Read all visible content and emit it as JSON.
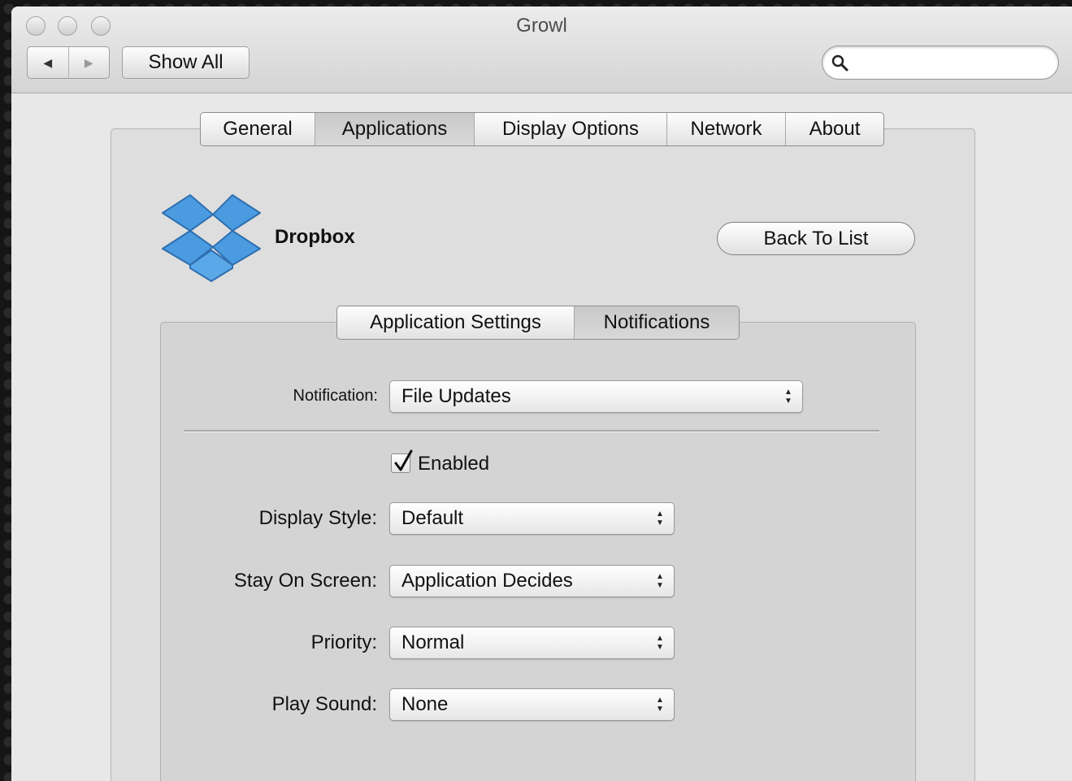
{
  "window": {
    "title": "Growl"
  },
  "toolbar": {
    "show_all_label": "Show All",
    "search_placeholder": ""
  },
  "main_tabs": [
    "General",
    "Applications",
    "Display Options",
    "Network",
    "About"
  ],
  "app": {
    "name": "Dropbox",
    "back_label": "Back To List"
  },
  "inner_tabs": [
    "Application Settings",
    "Notifications"
  ],
  "form": {
    "notification_label": "Notification:",
    "notification_value": "File Updates",
    "enabled_label": "Enabled",
    "enabled_checked": true,
    "display_style_label": "Display Style:",
    "display_style_value": "Default",
    "stay_label": "Stay On Screen:",
    "stay_value": "Application Decides",
    "priority_label": "Priority:",
    "priority_value": "Normal",
    "sound_label": "Play Sound:",
    "sound_value": "None"
  },
  "colors": {
    "window_bg": "#e8e8e8",
    "dropbox_blue": "#3d8fd6"
  }
}
